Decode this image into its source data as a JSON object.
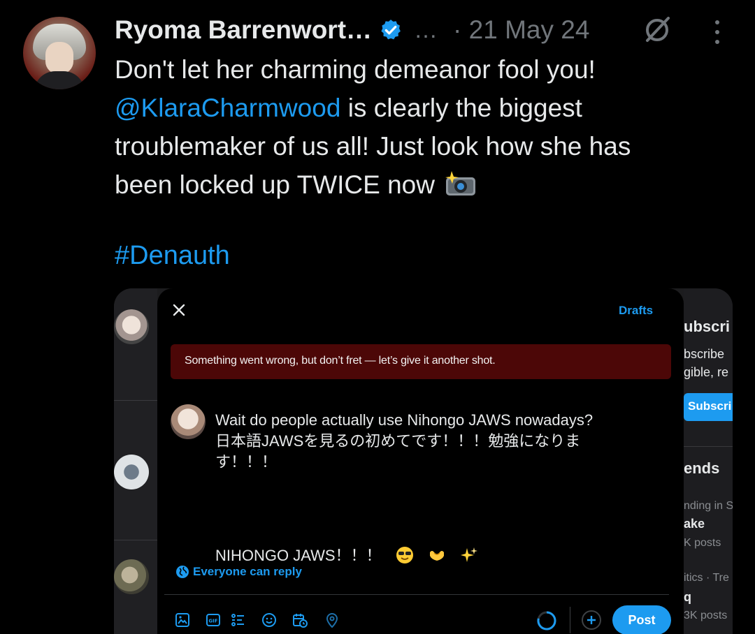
{
  "tweet": {
    "author_name": "Ryoma Barrenwort…",
    "more_inline": "…",
    "date": "· 21 May 24",
    "text_line1": "Don't let her charming demeanor fool you!",
    "mention": "@KlaraCharmwood",
    "text_line2_rest": " is clearly the biggest",
    "text_line3": "troublemaker of us all! Just look how she has",
    "text_line4": "been locked up TWICE now",
    "hashtag": "#Denauth"
  },
  "screenshot": {
    "drafts_label": "Drafts",
    "error_message": "Something went wrong, but don’t fret — let’s give it another shot.",
    "compose_line1": "Wait do people actually use Nihongo JAWS nowadays?",
    "compose_line2": "日本語JAWSを見るの初めてです！！！勉強になりま",
    "compose_line3": "す！！！",
    "compose_line4": "NIHONGO JAWS！！！",
    "reply_setting": "Everyone can reply",
    "post_label": "Post",
    "background_right": {
      "subscribe_heading": "ubscri",
      "subscribe_line1": "bscribe",
      "subscribe_line2": "gible, re",
      "subscribe_button": "Subscri",
      "trends_heading": "ends",
      "trend1_context": "nding in S",
      "trend1_name": "ake",
      "trend1_posts": "K posts",
      "trend2_context": "itics · Tre",
      "trend2_name": "q",
      "trend2_posts": "3K posts"
    }
  },
  "icons": [
    "verified-badge-icon",
    "grok-icon",
    "more-icon",
    "camera-flash-emoji",
    "close-icon",
    "globe-icon",
    "image-icon",
    "gif-icon",
    "poll-icon",
    "emoji-icon",
    "schedule-icon",
    "location-icon",
    "add-icon"
  ],
  "colors": {
    "accent": "#1d9bf0",
    "error_bg": "#4c0707",
    "background": "#000000",
    "muted": "#71767b"
  }
}
